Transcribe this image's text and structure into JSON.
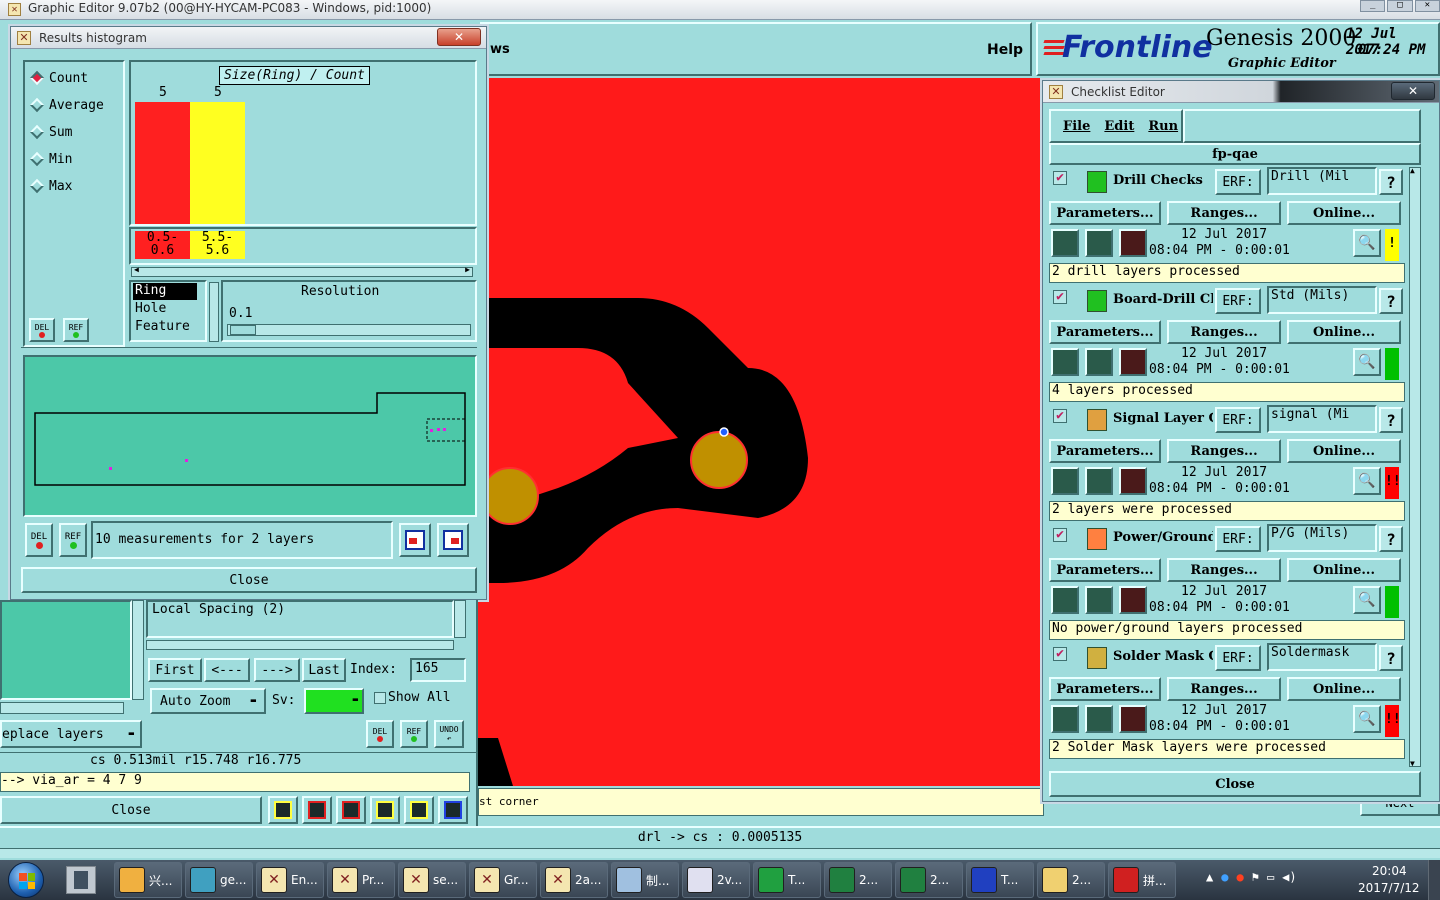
{
  "main_window": {
    "title": "Graphic Editor 9.07b2 (00@HY-HYCAM-PC083 - Windows, pid:1000)",
    "menu_partial": "ws",
    "help_label": "Help",
    "brand": "Frontline",
    "product": "Genesis 2000",
    "product_sub": "Graphic Editor",
    "date": "12 Jul 2017",
    "time": "07:24 PM",
    "status_text": "drl -> cs : 0.0005135",
    "prompt_partial": "st corner",
    "right_button_partial": "Next"
  },
  "histogram": {
    "title": "Results histogram",
    "modes": [
      {
        "label": "Count",
        "selected": true
      },
      {
        "label": "Average",
        "selected": false
      },
      {
        "label": "Sum",
        "selected": false
      },
      {
        "label": "Min",
        "selected": false
      },
      {
        "label": "Max",
        "selected": false
      }
    ],
    "chart_title": "Size(Ring) / Count",
    "bins": [
      {
        "count": "5",
        "range_top": "0.5-",
        "range_bottom": "0.6",
        "color": "#ff2020"
      },
      {
        "count": "5",
        "range_top": "5.5-",
        "range_bottom": "5.6",
        "color": "#ffff20"
      }
    ],
    "metrics": [
      {
        "label": "Ring",
        "selected": true
      },
      {
        "label": "Hole",
        "selected": false
      },
      {
        "label": "Feature",
        "selected": false
      }
    ],
    "resolution_label": "Resolution",
    "resolution_value": "0.1",
    "del_label": "DEL",
    "ref_label": "REF",
    "measurements_text": "10 measurements for 2 layers",
    "close_label": "Close"
  },
  "results_panel": {
    "list_item": "Local Spacing (2)",
    "first_label": "First",
    "prev_label": "<---",
    "next_label": "--->",
    "last_label": "Last",
    "index_label": "Index:",
    "index_value": "165",
    "auto_zoom_label": "Auto Zoom",
    "sv_label": "Sv:",
    "show_all_label": "Show All",
    "replace_layers_label": "eplace layers",
    "undo_label": "UNDO",
    "measure_line": "cs 0.513mil  r15.748  r16.775",
    "via_line": "--> via_ar = 4 7 9",
    "close_label": "Close"
  },
  "checklist": {
    "title": "Checklist Editor",
    "menu": [
      "File",
      "Edit",
      "Run"
    ],
    "name": "fp-qae",
    "erf_label": "ERF:",
    "parameters_label": "Parameters...",
    "ranges_label": "Ranges...",
    "online_label": "Online...",
    "help_label": "?",
    "close_label": "Close",
    "items": [
      {
        "name": "Drill Checks",
        "erf": "Drill (Mil",
        "date": "12 Jul 2017",
        "time": "08:04 PM - 0:00:01",
        "status": "!",
        "status_color": "#ffff00",
        "message": "2 drill layers processed",
        "icon_color": "#20c020"
      },
      {
        "name": "Board-Drill Che",
        "erf": "Std (Mils)",
        "date": "12 Jul 2017",
        "time": "08:04 PM - 0:00:01",
        "status": "",
        "status_color": "#00c000",
        "message": "4 layers processed",
        "icon_color": "#20c020"
      },
      {
        "name": "Signal Layer Ch",
        "erf": "signal (Mi",
        "date": "12 Jul 2017",
        "time": "08:04 PM - 0:00:01",
        "status": "!!",
        "status_color": "#ff0000",
        "message": "2 layers were processed",
        "icon_color": "#e0a040"
      },
      {
        "name": "Power/Ground C",
        "erf": "P/G (Mils)",
        "date": "12 Jul 2017",
        "time": "08:04 PM - 0:00:01",
        "status": "",
        "status_color": "#00c000",
        "message": "No power/ground layers processed",
        "icon_color": "#ff8040"
      },
      {
        "name": "Solder Mask Ch",
        "erf": "Soldermask",
        "date": "12 Jul 2017",
        "time": "08:04 PM - 0:00:01",
        "status": "!!",
        "status_color": "#ff0000",
        "message": "2 Solder Mask layers were processed",
        "icon_color": "#d0b040"
      }
    ]
  },
  "taskbar": {
    "items": [
      {
        "label": "兴...",
        "icon": "shell-icon"
      },
      {
        "label": "ge...",
        "icon": "eye-icon"
      },
      {
        "label": "En...",
        "icon": "x-window-icon"
      },
      {
        "label": "Pr...",
        "icon": "x-window-icon"
      },
      {
        "label": "se...",
        "icon": "x-window-icon"
      },
      {
        "label": "Gr...",
        "icon": "x-window-icon"
      },
      {
        "label": "2a...",
        "icon": "x-window-icon"
      },
      {
        "label": "制...",
        "icon": "notepad-icon"
      },
      {
        "label": "2v...",
        "icon": "text-icon"
      },
      {
        "label": "T...",
        "icon": "frontline-icon"
      },
      {
        "label": "2...",
        "icon": "excel-icon"
      },
      {
        "label": "2...",
        "icon": "excel-icon"
      },
      {
        "label": "T...",
        "icon": "floppy-icon"
      },
      {
        "label": "2...",
        "icon": "folder-icon"
      },
      {
        "label": "拼...",
        "icon": "pdf-icon"
      }
    ],
    "clock_time": "20:04",
    "clock_date": "2017/7/12"
  }
}
